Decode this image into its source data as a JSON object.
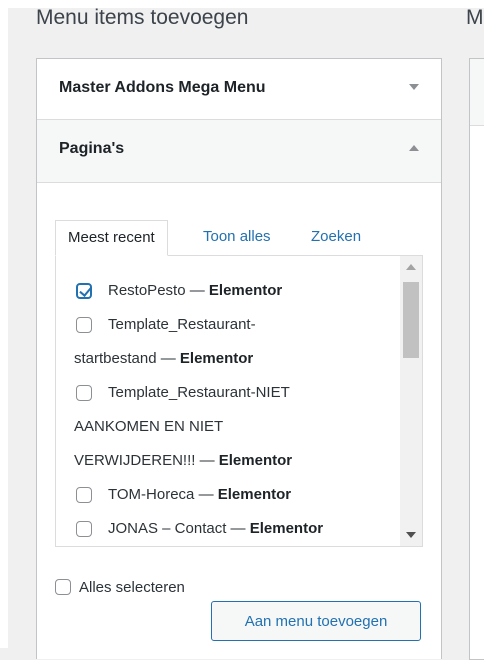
{
  "header": {
    "title": "Menu items toevoegen",
    "second_title": "M"
  },
  "accordion": {
    "sections": [
      {
        "label": "Master Addons Mega Menu",
        "state": "collapsed"
      },
      {
        "label": "Pagina's",
        "state": "expanded"
      }
    ]
  },
  "tabs": [
    {
      "label": "Meest recent",
      "active": true
    },
    {
      "label": "Toon alles",
      "active": false
    },
    {
      "label": "Zoeken",
      "active": false
    }
  ],
  "pages": [
    {
      "title": "RestoPesto",
      "suffix": "Elementor",
      "checked": true
    },
    {
      "title": "Template_Restaurant-startbestand",
      "suffix": "Elementor",
      "checked": false
    },
    {
      "title": "Template_Restaurant-NIET AANKOMEN EN NIET VERWIJDEREN!!!",
      "suffix": "Elementor",
      "checked": false
    },
    {
      "title": "TOM-Horeca",
      "suffix": "Elementor",
      "checked": false
    },
    {
      "title": "JONAS – Contact",
      "suffix": "Elementor",
      "checked": false
    }
  ],
  "lines": {
    "p0": "RestoPesto — ",
    "p1a": "Template_Restaurant-",
    "p1b": "startbestand — ",
    "p2a": "Template_Restaurant-NIET",
    "p2b": "AANKOMEN EN NIET",
    "p2c": "VERWIJDEREN!!! — ",
    "p3": "TOM-Horeca — ",
    "p4": "JONAS – Contact — ",
    "suffix": "Elementor"
  },
  "footer": {
    "select_all_label": "Alles selecteren",
    "add_button_label": "Aan menu toevoegen"
  },
  "colors": {
    "link": "#2271b1",
    "text": "#1d2327",
    "border": "#c3c4c7",
    "background": "#f0f0f1"
  }
}
